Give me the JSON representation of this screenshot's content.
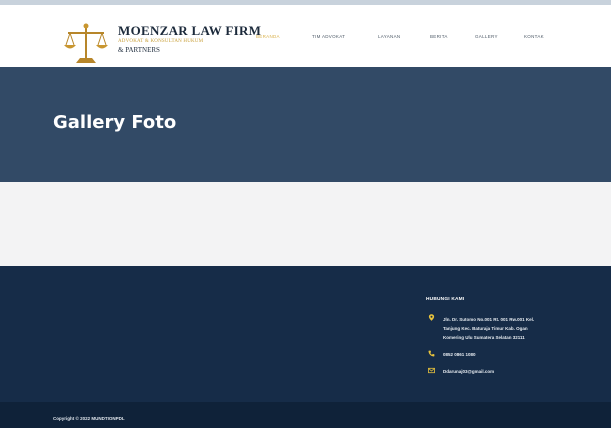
{
  "header": {
    "firm_name": "MOENZAR LAW FIRM",
    "firm_subtitle": "ADVOKAT & KONSULTAN HUKUM",
    "firm_partners": "& PARTNERS",
    "logo_icon": "scales-of-justice-icon"
  },
  "nav": {
    "items": [
      {
        "label": "BERANDA",
        "active": true
      },
      {
        "label": "TIM ADVOKAT",
        "active": false
      },
      {
        "label": "LAYANAN",
        "active": false
      },
      {
        "label": "BERITA",
        "active": false
      },
      {
        "label": "GALLERY",
        "active": false
      },
      {
        "label": "KONTAK",
        "active": false
      }
    ],
    "active_color": "#d9b14c"
  },
  "banner": {
    "title": "Gallery Foto",
    "background": "#324a66"
  },
  "footer": {
    "contact_heading": "HUBUNGI KAMI",
    "address_lines": [
      "Jln. Dr. Sutomo No.001 Rt. 001 Rw.001 Kel.",
      "Tanjung Kec. Baturaja Timur Kab. Ogan",
      "Komering Ulu Sumatera Selatan 32111"
    ],
    "phone": "0852 0861 1080",
    "email": "Ddarunaj03@gmail.com",
    "icons": {
      "address": "map-pin-icon",
      "phone": "phone-icon",
      "email": "envelope-icon"
    },
    "icon_color": "#e9c43d",
    "background": "#162c48"
  },
  "bottom": {
    "copyright": "Copyright © 2022 MUNDTIONPDL"
  }
}
